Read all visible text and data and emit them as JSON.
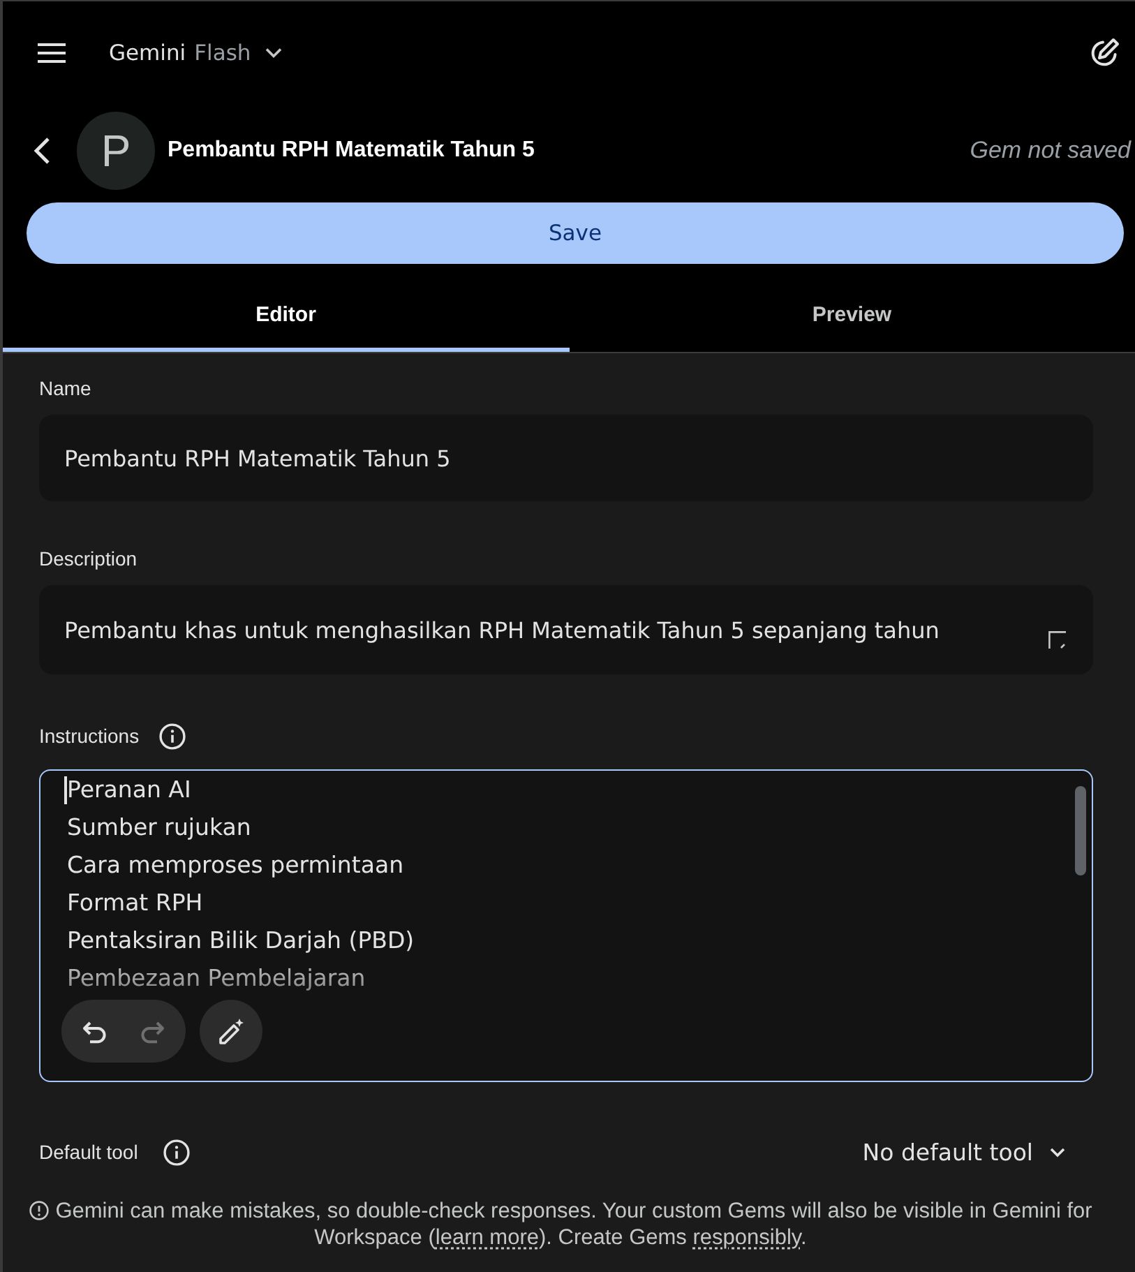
{
  "top_bar": {
    "brand": "Gemini",
    "model": "Flash"
  },
  "gem": {
    "avatar_letter": "P",
    "title": "Pembantu RPH Matematik Tahun 5",
    "status": "Gem not saved"
  },
  "save_button": {
    "label": "Save"
  },
  "tabs": [
    {
      "label": "Editor",
      "selected": true
    },
    {
      "label": "Preview",
      "selected": false
    }
  ],
  "name_field": {
    "label": "Name",
    "value": "Pembantu RPH Matematik Tahun 5"
  },
  "description_field": {
    "label": "Description",
    "value": "Pembantu khas untuk menghasilkan RPH Matematik Tahun 5 sepanjang tahun"
  },
  "instructions_field": {
    "label": "Instructions",
    "focused": true,
    "lines": [
      "Peranan AI",
      "Sumber rujukan",
      "Cara memproses permintaan",
      "Format RPH",
      "Pentaksiran Bilik Darjah (PBD)",
      "Pembezaan Pembelajaran"
    ],
    "history_buttons": [
      {
        "kind": "undo",
        "disabled": false
      },
      {
        "kind": "redo",
        "disabled": true
      }
    ]
  },
  "default_tool": {
    "label": "Default tool",
    "value": "No default tool"
  },
  "notice": {
    "parts": [
      {
        "kind": "text",
        "text": "Gemini can make mistakes, so double-check responses. Your custom Gems will also be visible in Gemini for Workspace ("
      },
      {
        "kind": "link",
        "text": "learn more"
      },
      {
        "kind": "text",
        "text": "). Create Gems "
      },
      {
        "kind": "link",
        "text": "responsibly"
      },
      {
        "kind": "text",
        "text": "."
      }
    ]
  }
}
